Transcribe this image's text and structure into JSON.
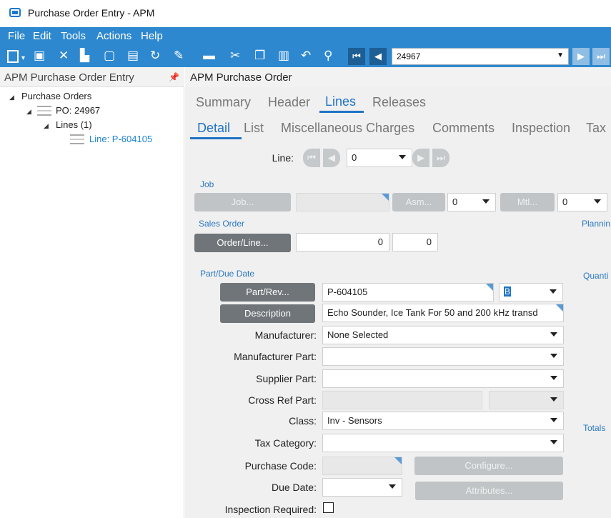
{
  "window": {
    "title": "Purchase Order Entry - APM"
  },
  "menu": [
    "File",
    "Edit",
    "Tools",
    "Actions",
    "Help"
  ],
  "toolbar": {
    "po_number": "24967",
    "icons": [
      "new-icon",
      "save-icon",
      "delete-icon",
      "attachments-icon",
      "notes-icon",
      "paste-icon",
      "refresh-icon",
      "clear-icon",
      "print-icon",
      "cut-icon",
      "copy-icon",
      "paste-insert-icon",
      "undo-icon",
      "search-icon",
      "first-record-icon",
      "previous-record-icon",
      "next-record-icon",
      "last-record-icon"
    ]
  },
  "tree": {
    "title": "APM Purchase Order Entry",
    "root": "Purchase Orders",
    "po": "PO: 24967",
    "lines": "Lines (1)",
    "line": "Line: P-604105"
  },
  "form": {
    "title": "APM Purchase Order",
    "tabs": [
      "Summary",
      "Header",
      "Lines",
      "Releases"
    ],
    "active_tab": "Lines",
    "subtabs": [
      "Detail",
      "List",
      "Miscellaneous Charges",
      "Comments",
      "Inspection",
      "Tax"
    ],
    "active_subtab": "Detail",
    "line_label": "Line:",
    "line_value": "0",
    "job_group": "Job",
    "job_button": "Job...",
    "asm_button": "Asm...",
    "asm_value": "0",
    "mtl_button": "Mtl...",
    "mtl_value": "0",
    "sales_order_group": "Sales Order",
    "order_line_button": "Order/Line...",
    "order_value": "0",
    "order_line_value": "0",
    "planning_label": "Plannin",
    "part_due_group": "Part/Due Date",
    "quantity_label": "Quanti",
    "totals_label": "Totals",
    "part_rev_button": "Part/Rev...",
    "part_value": "P-604105",
    "rev_value": "B",
    "description_button": "Description",
    "description_value": "Echo Sounder, Ice Tank For 50 and 200 kHz transd",
    "manufacturer_label": "Manufacturer:",
    "manufacturer_value": "None Selected",
    "manufacturer_part_label": "Manufacturer Part:",
    "supplier_part_label": "Supplier Part:",
    "cross_ref_part_label": "Cross Ref Part:",
    "class_label": "Class:",
    "class_value": "Inv - Sensors",
    "tax_category_label": "Tax Category:",
    "purchase_code_label": "Purchase Code:",
    "configure_button": "Configure...",
    "due_date_label": "Due Date:",
    "attributes_button": "Attributes...",
    "inspection_required_label": "Inspection Required:"
  },
  "colors": {
    "accent": "#2e88cf",
    "tab_active": "#1f73c6",
    "group_label": "#2a78c0"
  }
}
